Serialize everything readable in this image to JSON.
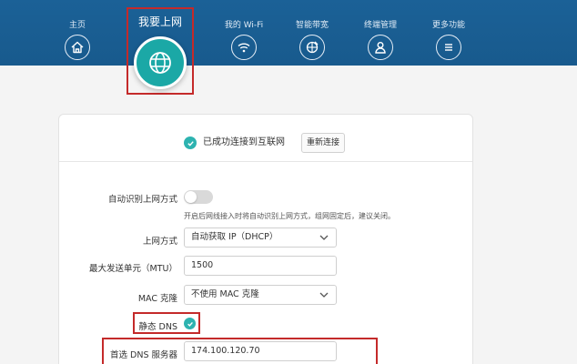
{
  "nav": {
    "items": [
      {
        "label": "主页",
        "icon": "home-icon"
      },
      {
        "label": "我的 Wi-Fi",
        "icon": "wifi-icon"
      },
      {
        "label": "智能带宽",
        "icon": "bandwidth-icon"
      },
      {
        "label": "终端管理",
        "icon": "user-icon"
      },
      {
        "label": "更多功能",
        "icon": "menu-icon"
      }
    ],
    "active": {
      "label": "我要上网",
      "icon": "globe-icon"
    }
  },
  "status": {
    "text": "已成功连接到互联网",
    "reconnect_label": "重新连接"
  },
  "form": {
    "auto_detect_label": "自动识别上网方式",
    "auto_detect_hint": "开启后网线接入时将自动识别上网方式，组网固定后，建议关闭。",
    "auto_detect_on": false,
    "mode_label": "上网方式",
    "mode_value": "自动获取 IP（DHCP）",
    "mtu_label": "最大发送单元（MTU）",
    "mtu_value": "1500",
    "mac_label": "MAC 克隆",
    "mac_value": "不使用 MAC 克隆",
    "static_dns_label": "静态 DNS",
    "static_dns_checked": true,
    "dns1_label": "首选 DNS 服务器",
    "dns1_value": "174.100.120.70"
  },
  "colors": {
    "header": "#185a8d",
    "accent": "#2db3b0",
    "highlight": "#c42a2a"
  }
}
